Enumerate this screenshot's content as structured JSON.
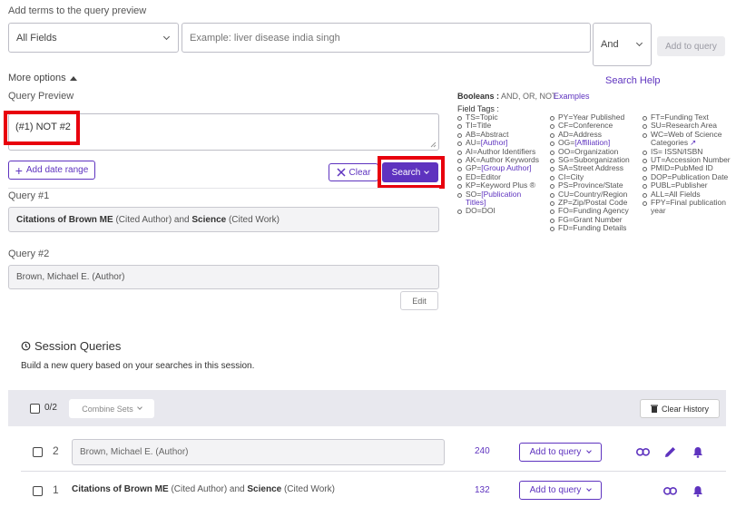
{
  "header": {
    "add_terms_label": "Add terms to the query preview",
    "field_select_value": "All Fields",
    "term_input_placeholder": "Example: liver disease india singh",
    "operator_value": "And",
    "add_to_query_label": "Add to query"
  },
  "options": {
    "more_options_label": "More options",
    "search_help_label": "Search Help"
  },
  "query_preview": {
    "label": "Query Preview",
    "value": "(#1) NOT #2",
    "add_date_range_label": "Add date range",
    "clear_label": "Clear",
    "search_label": "Search"
  },
  "booleans": {
    "label": "Booleans :",
    "values": "AND, OR, NOT",
    "examples_label": "Examples",
    "field_tags_label": "Field Tags :"
  },
  "field_tags": {
    "col1": [
      {
        "text": "TS=Topic"
      },
      {
        "text": "TI=Title"
      },
      {
        "text": "AB=Abstract"
      },
      {
        "text": "AU=",
        "link": "[Author]"
      },
      {
        "text": "AI=Author Identifiers"
      },
      {
        "text": "AK=Author Keywords"
      },
      {
        "text": "GP=",
        "link": "[Group Author]"
      },
      {
        "text": "ED=Editor"
      },
      {
        "text": "KP=Keyword Plus ®"
      },
      {
        "text": "SO=",
        "link": "[Publication Titles]"
      },
      {
        "text": "DO=DOI"
      }
    ],
    "col2": [
      {
        "text": "PY=Year Published"
      },
      {
        "text": "CF=Conference"
      },
      {
        "text": "AD=Address"
      },
      {
        "text": "OG=",
        "link": "[Affiliation]"
      },
      {
        "text": "OO=Organization"
      },
      {
        "text": "SG=Suborganization"
      },
      {
        "text": "SA=Street Address"
      },
      {
        "text": "CI=City"
      },
      {
        "text": "PS=Province/State"
      },
      {
        "text": "CU=Country/Region"
      },
      {
        "text": "ZP=Zip/Postal Code"
      },
      {
        "text": "FO=Funding Agency"
      },
      {
        "text": "FG=Grant Number"
      },
      {
        "text": "FD=Funding Details"
      }
    ],
    "col3": [
      {
        "text": "FT=Funding Text"
      },
      {
        "text": "SU=Research Area"
      },
      {
        "text": "WC=Web of Science Categories"
      },
      {
        "text": "IS= ISSN/ISBN"
      },
      {
        "text": "UT=Accession Number"
      },
      {
        "text": "PMID=PubMed ID"
      },
      {
        "text": "DOP=Publication Date"
      },
      {
        "text": "PUBL=Publisher"
      },
      {
        "text": "ALL=All Fields"
      },
      {
        "text": "FPY=Final publication year"
      }
    ]
  },
  "queries": [
    {
      "label": "Query #1",
      "parts": [
        {
          "t": "Citations of Brown ME",
          "b": true
        },
        {
          "t": " (Cited Author) and ",
          "b": false
        },
        {
          "t": "Science",
          "b": true
        },
        {
          "t": " (Cited Work)",
          "b": false
        }
      ]
    },
    {
      "label": "Query #2",
      "parts": [
        {
          "t": "Brown, Michael E. (Author)",
          "b": false
        }
      ],
      "edit_label": "Edit"
    }
  ],
  "session": {
    "title": "Session Queries",
    "subtitle": "Build a new query based on your searches in this session.",
    "selected_count": "0/2",
    "combine_sets_label": "Combine Sets",
    "clear_history_label": "Clear History",
    "rows": [
      {
        "number": "2",
        "parts": [
          {
            "t": "Brown, Michael E. (Author)",
            "b": false
          }
        ],
        "results": "240",
        "add_label": "Add to query"
      },
      {
        "number": "1",
        "parts": [
          {
            "t": "Citations of Brown ME",
            "b": true
          },
          {
            "t": " (Cited Author) and ",
            "b": false
          },
          {
            "t": "Science",
            "b": true
          },
          {
            "t": " (Cited Work)",
            "b": false
          }
        ],
        "results": "132",
        "add_label": "Add to query"
      }
    ]
  },
  "colors": {
    "accent": "#5e33bf",
    "highlight": "#e8000d"
  }
}
